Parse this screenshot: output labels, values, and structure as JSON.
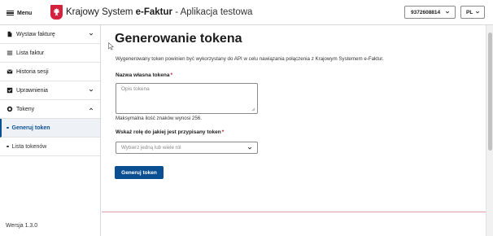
{
  "header": {
    "menu_label": "Menu",
    "brand_main": "Krajowy System ",
    "brand_bold": "e-Faktur",
    "brand_sub": " - Aplikacja testowa",
    "nip": "9372608814",
    "lang": "PL"
  },
  "sidebar": {
    "items": [
      {
        "label": "Wystaw fakturę",
        "icon": "document-icon"
      },
      {
        "label": "Lista faktur",
        "icon": "list-icon"
      },
      {
        "label": "Historia sesji",
        "icon": "envelope-icon"
      },
      {
        "label": "Uprawnienia",
        "icon": "checkbox-icon"
      },
      {
        "label": "Tokeny",
        "icon": "token-icon"
      }
    ],
    "subitems": [
      {
        "label": "Generuj token",
        "active": true
      },
      {
        "label": "Lista tokenów",
        "active": false
      }
    ],
    "version": "Wersja 1.3.0"
  },
  "main": {
    "title": "Generowanie tokena",
    "description": "Wygenerowany token powinien być wykorzystany do API w celu nawiązania połączenia z Krajowym Systemem e-Faktur.",
    "name_label": "Nazwa własna tokena",
    "required_mark": "*",
    "name_placeholder": "Opis tokena",
    "name_hint": "Maksymalna ilość znaków wynosi 256.",
    "role_label": "Wskaż rolę do jakiej jest przypisany token",
    "role_placeholder": "Wybierz jedną lub wiele ról",
    "generate_button": "Generuj token"
  },
  "colors": {
    "primary": "#0b4f93",
    "required": "#c4122f",
    "emblem": "#d4213d",
    "divider_accent": "#e8a0aa"
  }
}
